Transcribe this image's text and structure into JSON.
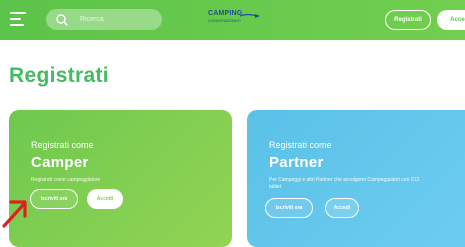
{
  "header": {
    "search_placeholder": "Ricerca",
    "logo_text": "CAMPING",
    "logo_sub": "CONVENZIONATI",
    "register_label": "Registrati",
    "login_label": "Accedi"
  },
  "page": {
    "title": "Registrati"
  },
  "cards": {
    "camper": {
      "subtitle": "Registrati come",
      "title": "Camper",
      "description": "Registrati come campeggiatore",
      "primary_label": "Iscriviti ora",
      "secondary_label": "Accedi"
    },
    "partner": {
      "subtitle": "Registrati come",
      "title": "Partner",
      "description": "Per Campeggi e altri Partner che accolgono Campeggiatori con CCI tablet",
      "primary_label": "Iscriviti ora",
      "secondary_label": "Accedi"
    }
  },
  "colors": {
    "header_green": "#5cc44a",
    "title_green": "#43bb61",
    "camper_card": "#6ec94f",
    "partner_card": "#5bc1e8",
    "logo_blue": "#1d4f91",
    "annotation_red": "#e02020"
  },
  "icons": {
    "menu": "hamburger-menu-icon",
    "search": "search-icon",
    "annotation": "red-arrow-icon"
  }
}
